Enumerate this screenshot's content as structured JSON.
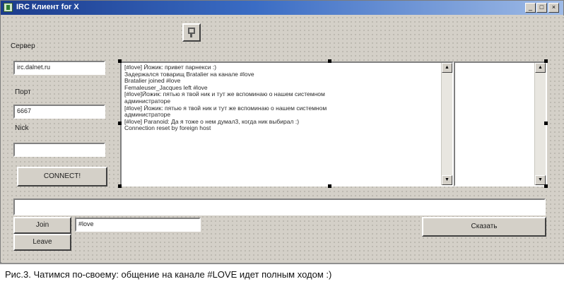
{
  "window": {
    "title": "IRC Клиент for X",
    "minimize_glyph": "_",
    "maximize_glyph": "□",
    "close_glyph": "×"
  },
  "labels": {
    "server": "Сервер",
    "port": "Порт",
    "nick": "Nick"
  },
  "fields": {
    "server_value": "irc.dalnet.ru",
    "port_value": "6667",
    "nick_value": "",
    "channel_value": "#love",
    "message_value": ""
  },
  "buttons": {
    "connect": "CONNECT!",
    "join": "Join",
    "leave": "Leave",
    "say": "Сказать"
  },
  "chat": {
    "lines": [
      "[#love] Йожик: привет парнекси :)",
      "Задержался товарищ Bratalier на канале #love",
      "Bratalier joined #love",
      "Femaleuser_Jacques left #love",
      "[#love]Йожик: пятью я твой ник и тут же вспоминаю о нашем системном",
      "администраторе",
      "[#love] Йожик: пятью я твой ник и тут же вспоминаю о нашем системном",
      "администраторе",
      "[#love] Paranoid: Да я тоже о нем думал3, когда ник выбирал :)",
      "Connection reset by foreign host"
    ]
  },
  "icons": {
    "toolbar": "component-icon",
    "app": "app-icon"
  },
  "caption": "Рис.3. Чатимся по-своему: общение на канале #LOVE идет полным ходом :)"
}
